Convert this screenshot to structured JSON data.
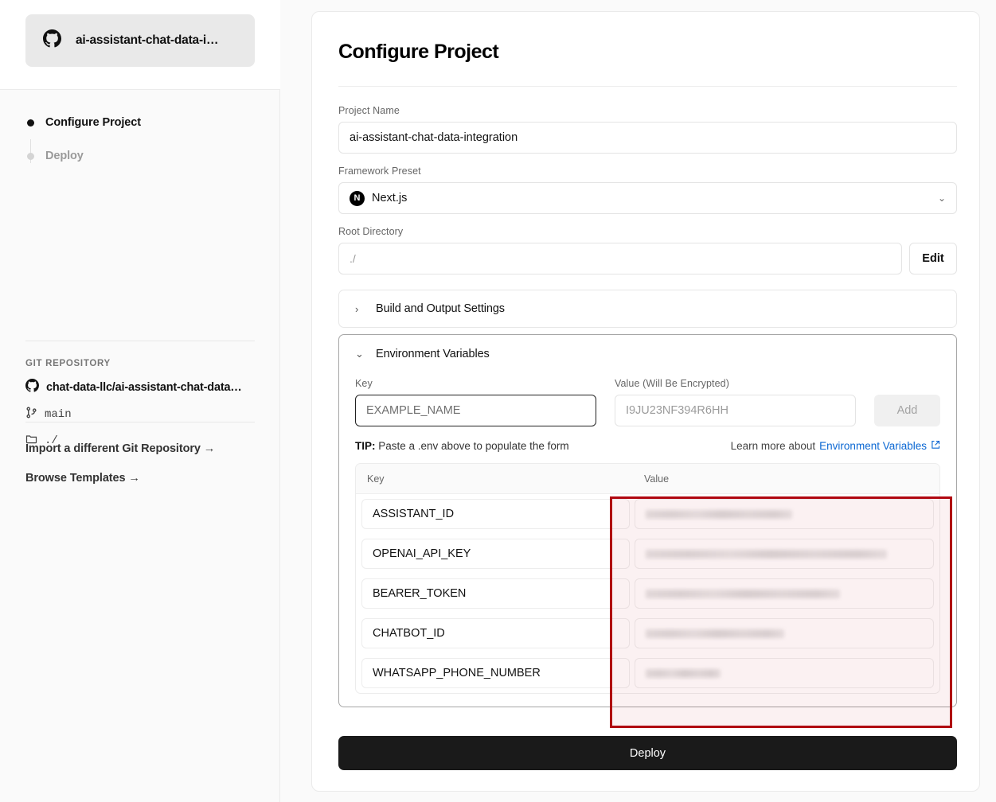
{
  "sidebar": {
    "repo_pill": {
      "icon": "github-icon",
      "name": "ai-assistant-chat-data-i…"
    },
    "steps": [
      {
        "label": "Configure Project",
        "state": "active"
      },
      {
        "label": "Deploy",
        "state": "inactive"
      }
    ],
    "git": {
      "heading": "GIT REPOSITORY",
      "repo": "chat-data-llc/ai-assistant-chat-data…",
      "branch": "main",
      "directory": "./"
    },
    "links": [
      {
        "label": "Import a different Git Repository →"
      },
      {
        "label": "Browse Templates →"
      }
    ]
  },
  "main": {
    "title": "Configure Project",
    "project_name": {
      "label": "Project Name",
      "value": "ai-assistant-chat-data-integration"
    },
    "framework_preset": {
      "label": "Framework Preset",
      "value": "Next.js",
      "logo_letter": "N",
      "chevron": "⌄"
    },
    "root_directory": {
      "label": "Root Directory",
      "value": "./",
      "edit_label": "Edit"
    },
    "build_output": {
      "label": "Build and Output Settings",
      "arrow": "›"
    },
    "environment_variables": {
      "label": "Environment Variables",
      "arrow": "⌄",
      "key_field": {
        "label": "Key",
        "placeholder": "EXAMPLE_NAME"
      },
      "value_field": {
        "label": "Value (Will Be Encrypted)",
        "placeholder": "I9JU23NF394R6HH"
      },
      "add_label": "Add",
      "tip_prefix": "TIP:",
      "tip_text": " Paste a .env above to populate the form",
      "learn_more_prefix": "Learn more about ",
      "learn_more_link": "Environment Variables",
      "external_icon": "external-link-icon",
      "table": {
        "columns": [
          "Key",
          "Value"
        ],
        "rows": [
          {
            "key": "ASSISTANT_ID",
            "value_masked": true,
            "bar_width": "53%"
          },
          {
            "key": "OPENAI_API_KEY",
            "value_masked": true,
            "bar_width": "87%"
          },
          {
            "key": "BEARER_TOKEN",
            "value_masked": true,
            "bar_width": "70%"
          },
          {
            "key": "CHATBOT_ID",
            "value_masked": true,
            "bar_width": "50%"
          },
          {
            "key": "WHATSAPP_PHONE_NUMBER",
            "value_masked": true,
            "bar_width": "27%"
          }
        ]
      }
    },
    "deploy_label": "Deploy"
  },
  "annotation": {
    "highlight_color": "#b00710"
  }
}
